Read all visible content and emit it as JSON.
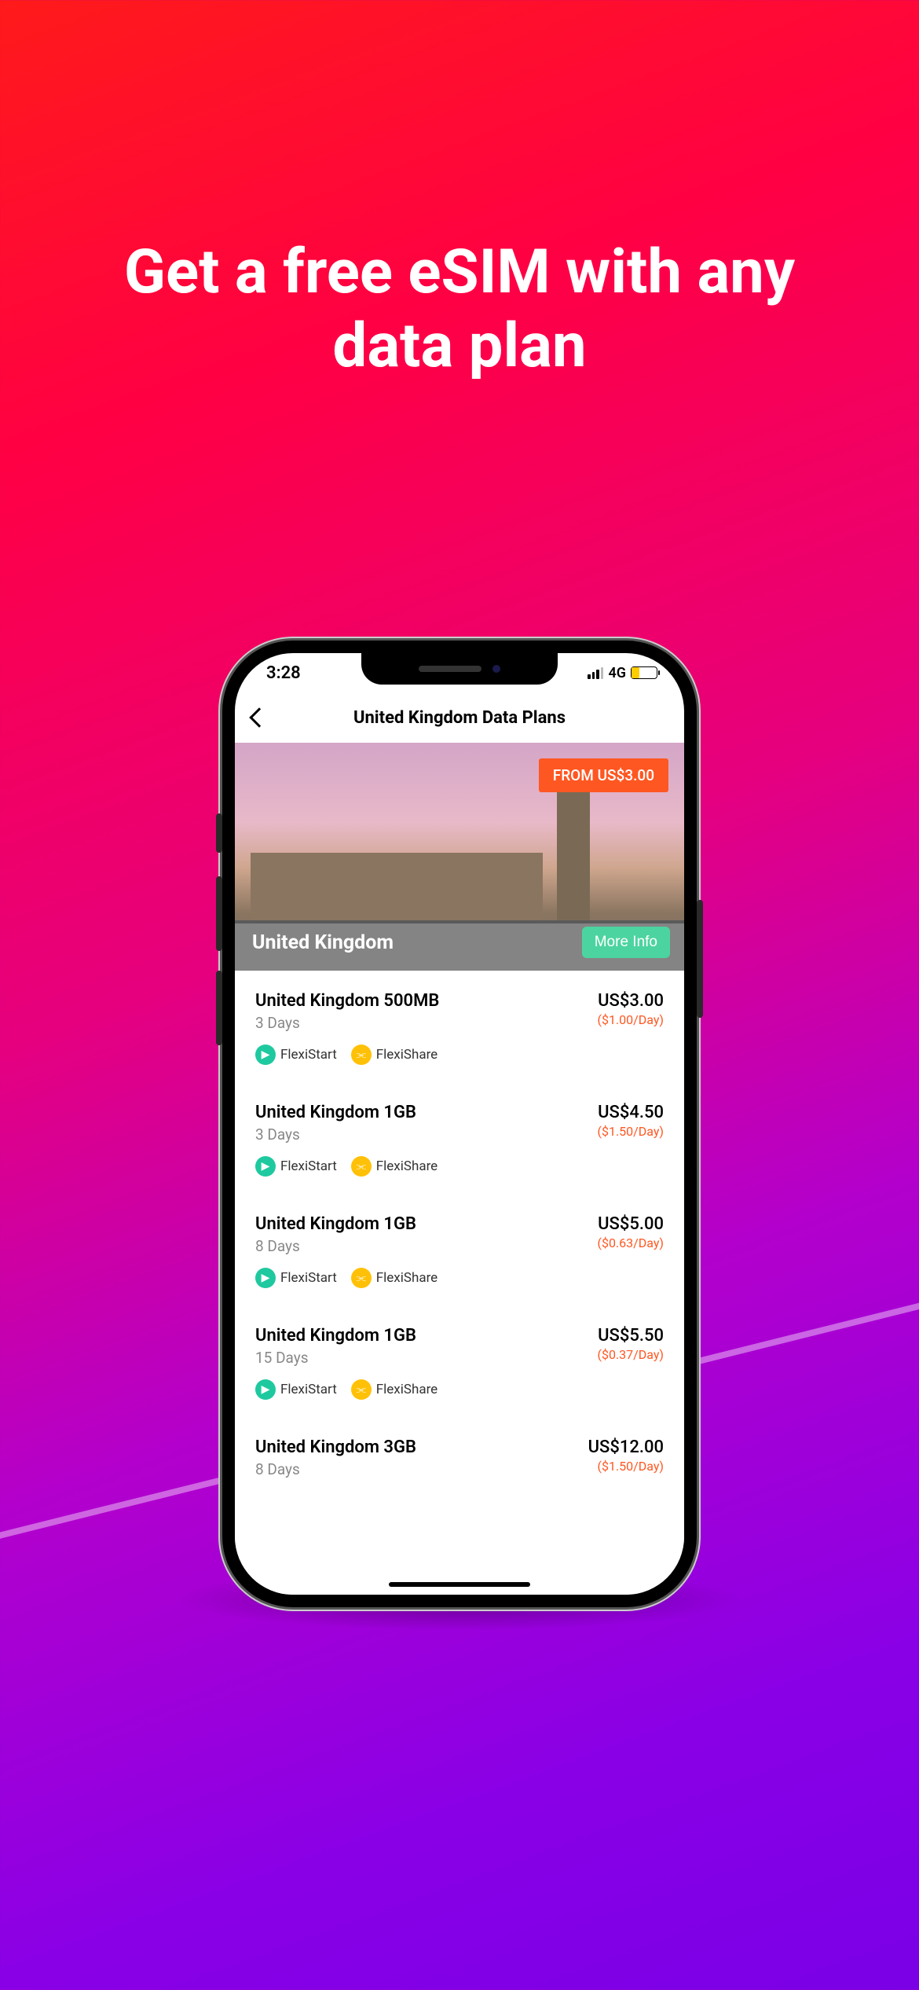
{
  "marketing": {
    "headline": "Get a free eSIM with any data plan"
  },
  "statusBar": {
    "time": "3:28",
    "network": "4G"
  },
  "nav": {
    "title": "United Kingdom Data Plans"
  },
  "hero": {
    "fromBadge": "FROM US$3.00",
    "country": "United Kingdom",
    "moreInfo": "More Info"
  },
  "badges": {
    "flexistart": "FlexiStart",
    "flexishare": "FlexiShare"
  },
  "plans": [
    {
      "name": "United Kingdom 500MB",
      "duration": "3 Days",
      "price": "US$3.00",
      "perDay": "($1.00/Day)"
    },
    {
      "name": "United Kingdom 1GB",
      "duration": "3 Days",
      "price": "US$4.50",
      "perDay": "($1.50/Day)"
    },
    {
      "name": "United Kingdom 1GB",
      "duration": "8 Days",
      "price": "US$5.00",
      "perDay": "($0.63/Day)"
    },
    {
      "name": "United Kingdom 1GB",
      "duration": "15 Days",
      "price": "US$5.50",
      "perDay": "($0.37/Day)"
    },
    {
      "name": "United Kingdom 3GB",
      "duration": "8 Days",
      "price": "US$12.00",
      "perDay": "($1.50/Day)"
    }
  ]
}
